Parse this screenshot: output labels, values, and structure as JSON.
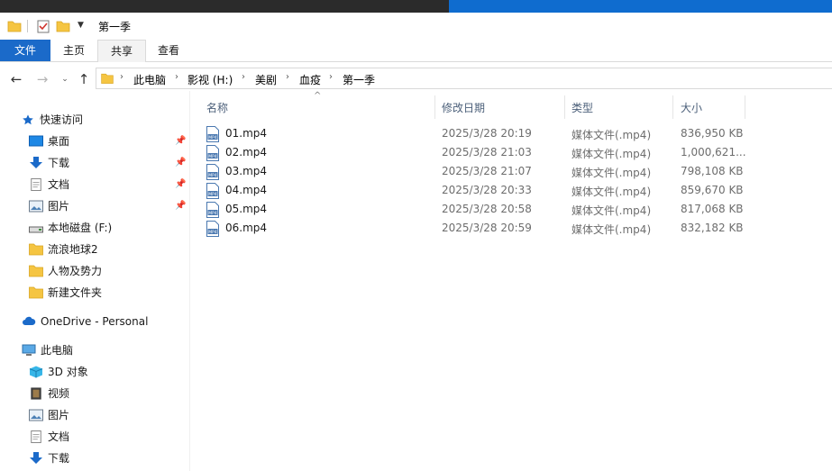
{
  "window": {
    "title": "第一季"
  },
  "ribbon": {
    "tabs": [
      {
        "label": "文件"
      },
      {
        "label": "主页"
      },
      {
        "label": "共享"
      },
      {
        "label": "查看"
      }
    ]
  },
  "address": {
    "crumbs": [
      "此电脑",
      "影视 (H:)",
      "美剧",
      "血疫",
      "第一季"
    ]
  },
  "sidebar": {
    "items": [
      {
        "label": "快速访问",
        "icon": "star-icon",
        "pinned": false
      },
      {
        "label": "桌面",
        "icon": "desktop-icon",
        "pinned": true
      },
      {
        "label": "下载",
        "icon": "download-icon",
        "pinned": true
      },
      {
        "label": "文档",
        "icon": "document-icon",
        "pinned": true
      },
      {
        "label": "图片",
        "icon": "pictures-icon",
        "pinned": true
      },
      {
        "label": "本地磁盘 (F:)",
        "icon": "drive-icon",
        "pinned": false
      },
      {
        "label": "流浪地球2",
        "icon": "folder-icon",
        "pinned": false
      },
      {
        "label": "人物及势力",
        "icon": "folder-icon",
        "pinned": false
      },
      {
        "label": "新建文件夹",
        "icon": "folder-icon",
        "pinned": false
      },
      {
        "label": "OneDrive - Personal",
        "icon": "cloud-icon",
        "pinned": false
      },
      {
        "label": "此电脑",
        "icon": "computer-icon",
        "pinned": false
      },
      {
        "label": "3D 对象",
        "icon": "cube-icon",
        "pinned": false
      },
      {
        "label": "视频",
        "icon": "video-icon",
        "pinned": false
      },
      {
        "label": "图片",
        "icon": "pictures-icon",
        "pinned": false
      },
      {
        "label": "文档",
        "icon": "document-icon",
        "pinned": false
      },
      {
        "label": "下载",
        "icon": "download-icon",
        "pinned": false
      }
    ]
  },
  "list": {
    "columns": [
      "名称",
      "修改日期",
      "类型",
      "大小"
    ],
    "files": [
      {
        "name": "01.mp4",
        "date": "2025/3/28 20:19",
        "type": "媒体文件(.mp4)",
        "size": "836,950 KB"
      },
      {
        "name": "02.mp4",
        "date": "2025/3/28 21:03",
        "type": "媒体文件(.mp4)",
        "size": "1,000,621..."
      },
      {
        "name": "03.mp4",
        "date": "2025/3/28 21:07",
        "type": "媒体文件(.mp4)",
        "size": "798,108 KB"
      },
      {
        "name": "04.mp4",
        "date": "2025/3/28 20:33",
        "type": "媒体文件(.mp4)",
        "size": "859,670 KB"
      },
      {
        "name": "05.mp4",
        "date": "2025/3/28 20:58",
        "type": "媒体文件(.mp4)",
        "size": "817,068 KB"
      },
      {
        "name": "06.mp4",
        "date": "2025/3/28 20:59",
        "type": "媒体文件(.mp4)",
        "size": "832,182 KB"
      }
    ]
  },
  "colors": {
    "accent": "#1b6ac9",
    "folder": "#f5c542",
    "header_text": "#4c607a"
  }
}
